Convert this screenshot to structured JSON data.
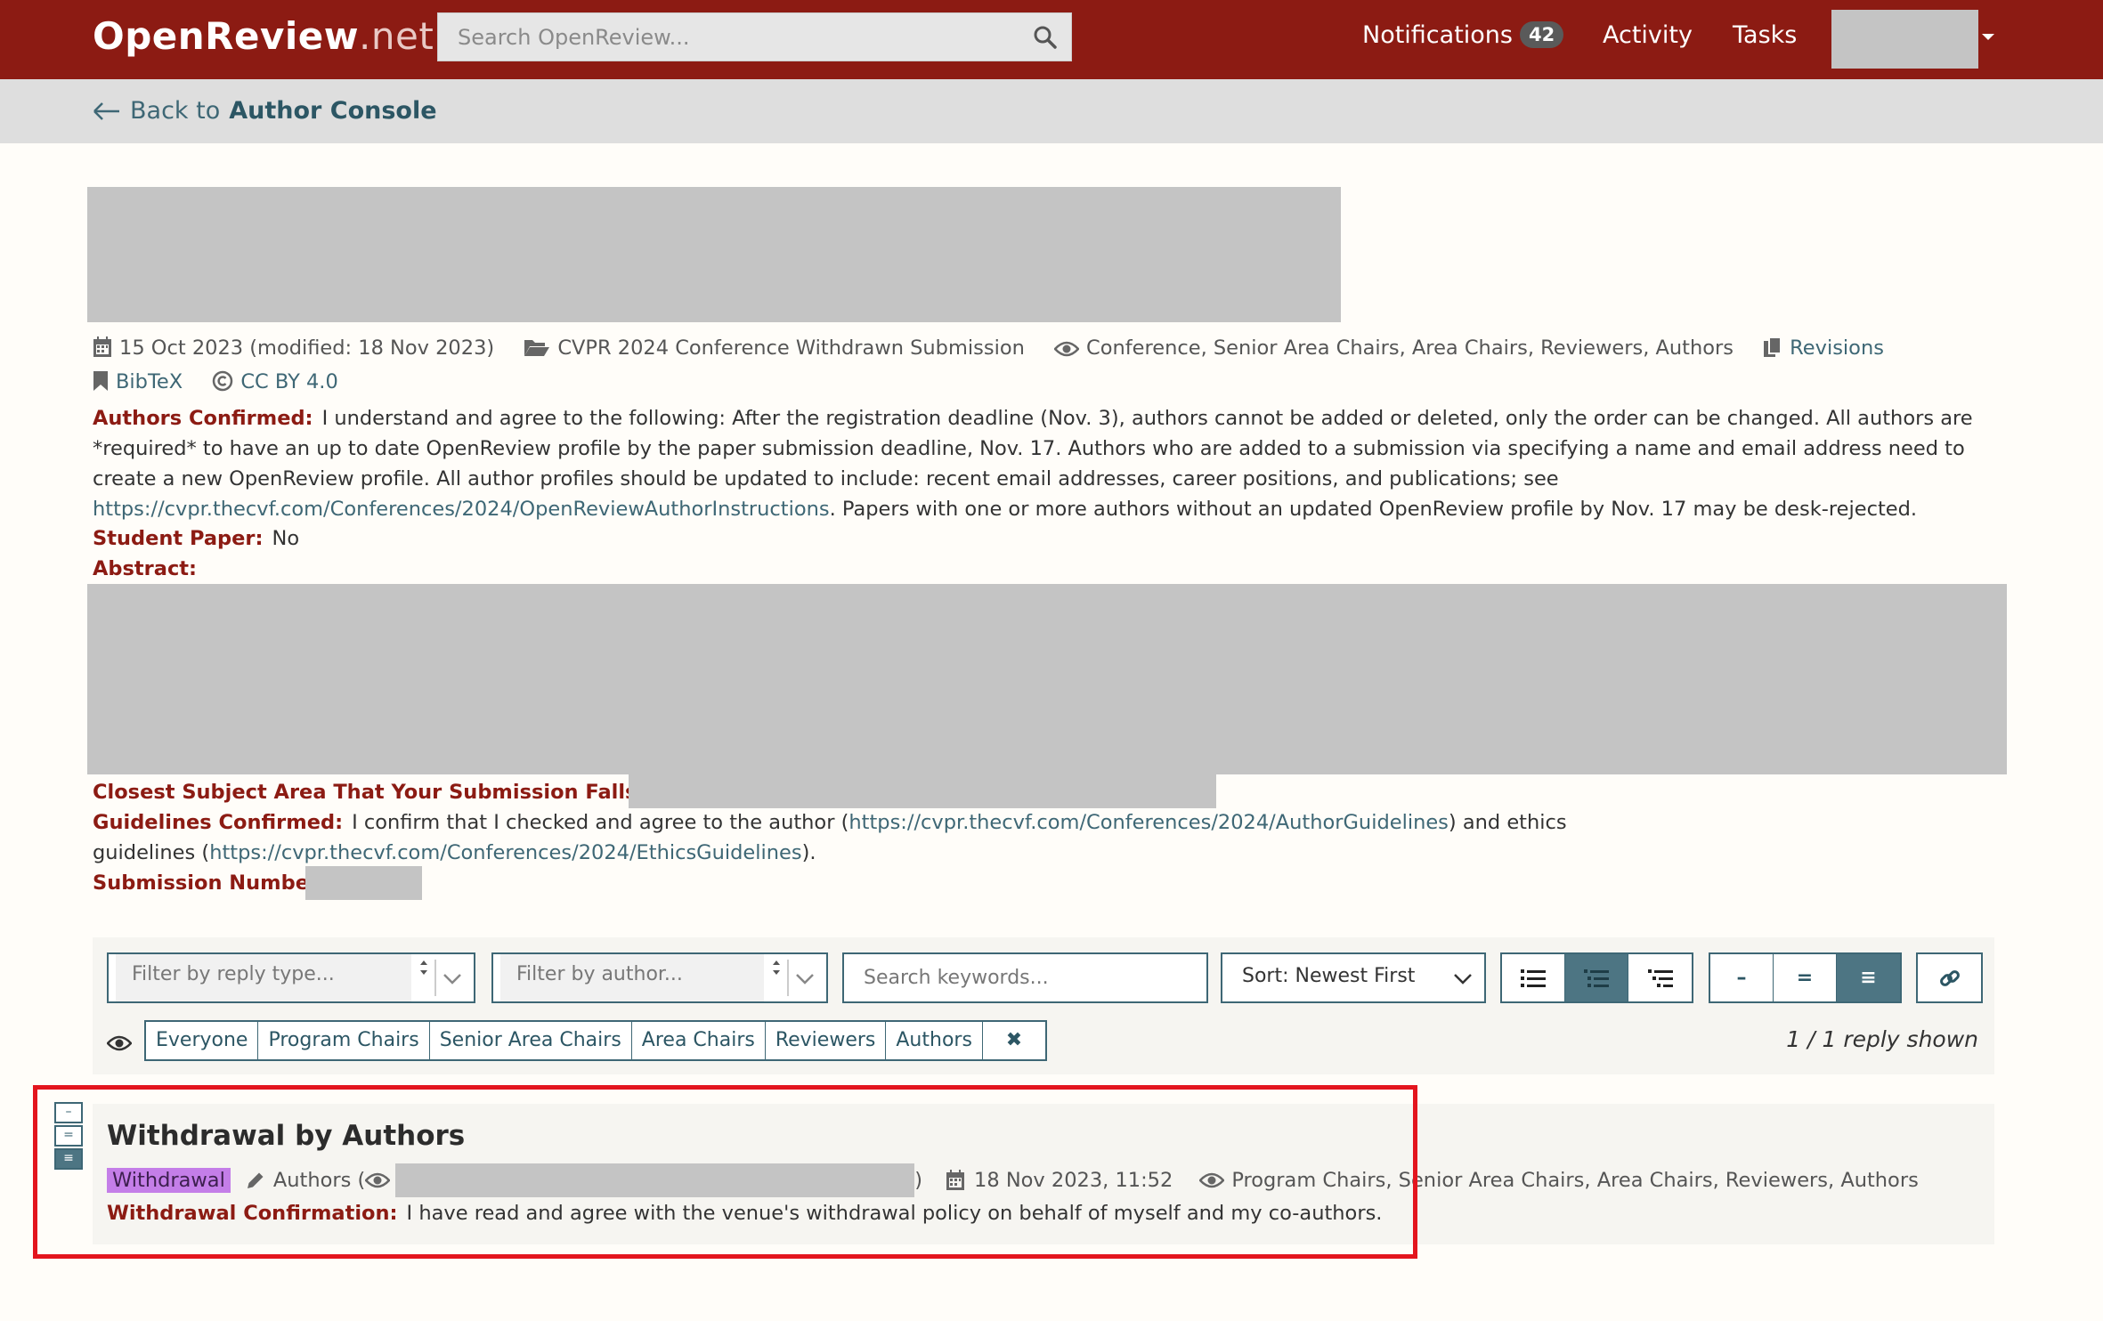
{
  "navbar": {
    "logo_main": "OpenReview",
    "logo_suffix": ".net",
    "search_placeholder": "Search OpenReview...",
    "notifications_label": "Notifications",
    "notifications_count": "42",
    "activity_label": "Activity",
    "tasks_label": "Tasks"
  },
  "subnav": {
    "back_prefix": "Back to",
    "back_target": "Author Console"
  },
  "note": {
    "date": "15 Oct 2023 (modified: 18 Nov 2023)",
    "venue": "CVPR 2024 Conference Withdrawn Submission",
    "readers": "Conference, Senior Area Chairs, Area Chairs, Reviewers, Authors",
    "revisions_label": "Revisions",
    "bibtex_label": "BibTeX",
    "license": "CC BY 4.0",
    "fields": {
      "authors_confirmed_label": "Authors Confirmed:",
      "authors_confirmed_text_1": "I understand and agree to the following: After the registration deadline (Nov. 3), authors cannot be added or deleted, only the order can be changed. All authors are *required* to have an up to date OpenReview profile by the paper submission deadline, Nov. 17. Authors who are added to a submission via specifying a name and email address need to create a new OpenReview profile. All author profiles should be updated to include: recent email addresses, career positions, and publications; see ",
      "authors_confirmed_link": "https://cvpr.thecvf.com/Conferences/2024/OpenReviewAuthorInstructions",
      "authors_confirmed_text_2": ". Papers with one or more authors without an updated OpenReview profile by Nov. 17 may be desk-rejected.",
      "student_paper_label": "Student Paper:",
      "student_paper_value": "No",
      "abstract_label": "Abstract:",
      "subject_area_label": "Closest Subject Area That Your Submission Falls Into:",
      "guidelines_label": "Guidelines Confirmed:",
      "guidelines_text_1": "I confirm that I checked and agree to the author (",
      "guidelines_link_1": "https://cvpr.thecvf.com/Conferences/2024/AuthorGuidelines",
      "guidelines_text_2": ") and ethics guidelines (",
      "guidelines_link_2": "https://cvpr.thecvf.com/Conferences/2024/EthicsGuidelines",
      "guidelines_text_3": ").",
      "submission_number_label": "Submission Number:"
    }
  },
  "filters": {
    "reply_type_placeholder": "Filter by reply type...",
    "author_placeholder": "Filter by author...",
    "keywords_placeholder": "Search keywords...",
    "sort_label": "Sort: Newest First",
    "readers": [
      "Everyone",
      "Program Chairs",
      "Senior Area Chairs",
      "Area Chairs",
      "Reviewers",
      "Authors"
    ],
    "clear_glyph": "✖",
    "reply_count": "1 / 1 reply shown",
    "density_minus": "–",
    "density_equal": "=",
    "density_full": "≡"
  },
  "reply": {
    "title": "Withdrawal by Authors",
    "badge": "Withdrawal",
    "signature_prefix": "Authors (",
    "signature_suffix": ")",
    "date": "18 Nov 2023, 11:52",
    "readers": "Program Chairs, Senior Area Chairs, Area Chairs, Reviewers, Authors",
    "field_label": "Withdrawal Confirmation:",
    "field_value": "I have read and agree with the venue's withdrawal policy on behalf of myself and my co-authors."
  },
  "colors": {
    "navbar": "#8c1b13",
    "accent": "#3e6775",
    "field_label": "#8c1b13",
    "highlight": "#e3151e",
    "badge": "#c47ee8"
  }
}
